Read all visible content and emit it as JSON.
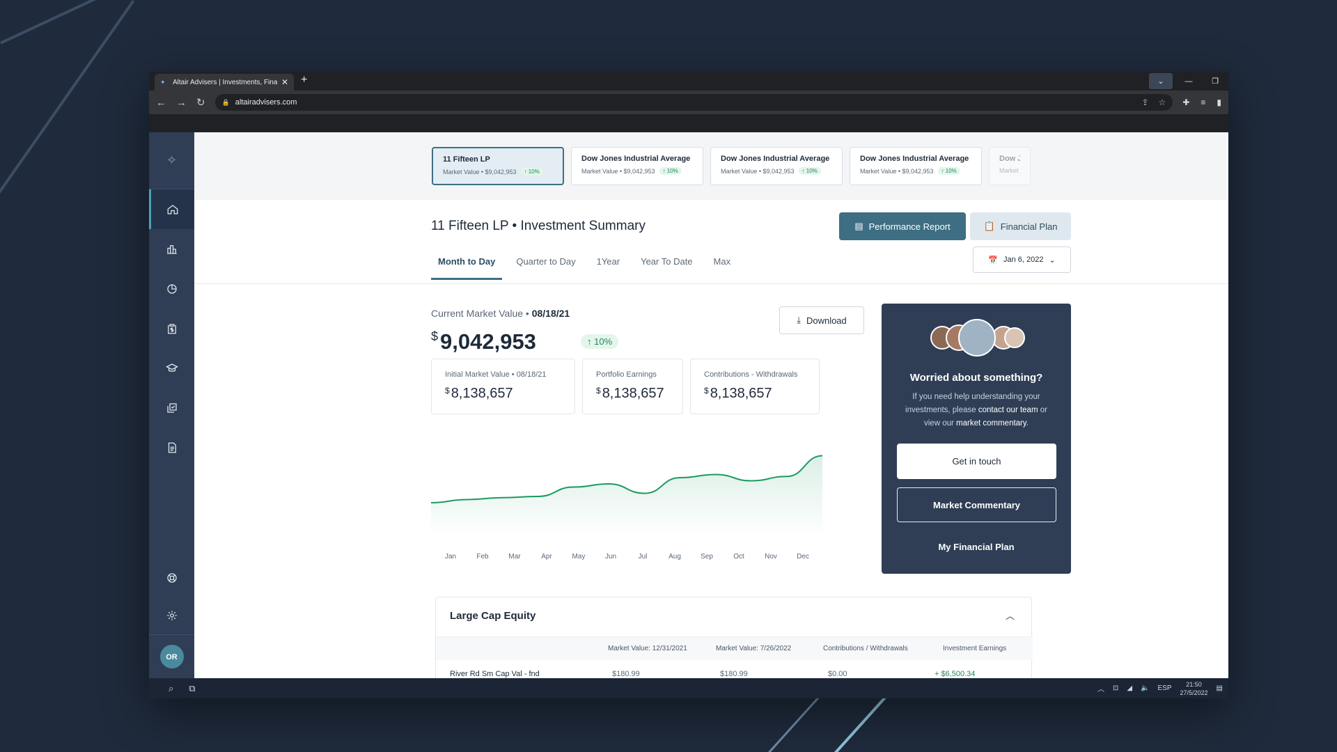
{
  "browser": {
    "tab_title": "Altair Advisers | Investments, Fina",
    "url": "altairadvisers.com"
  },
  "accounts": [
    {
      "name": "11 Fifteen LP",
      "market_value": "Market Value • $9,042,953",
      "change": "↑ 10%",
      "active": true
    },
    {
      "name": "Dow Jones Industrial Average",
      "market_value": "Market Value • $9,042,953",
      "change": "↑ 10%"
    },
    {
      "name": "Dow Jones Industrial Average",
      "market_value": "Market Value • $9,042,953",
      "change": "↑ 10%"
    },
    {
      "name": "Dow Jones Industrial Average",
      "market_value": "Market Value • $9,042,953",
      "change": "↑ 10%"
    },
    {
      "name": "Dow Jo",
      "market_value": "Market"
    }
  ],
  "page": {
    "title": "11 Fifteen LP • Investment Summary",
    "performance_report": "Performance Report",
    "financial_plan": "Financial Plan",
    "date": "Jan 6, 2022"
  },
  "tabs": [
    "Month to Day",
    "Quarter to Day",
    "1Year",
    "Year To Date",
    "Max"
  ],
  "summary": {
    "cmv_label": "Current Market Value •",
    "cmv_date": "08/18/21",
    "currency": "$",
    "cmv_value": "9,042,953",
    "cmv_change": "↑ 10%",
    "download": "Download"
  },
  "stats": [
    {
      "label": "Initial Market Value • 08/18/21",
      "value": "8,138,657"
    },
    {
      "label": "Portfolio Earnings",
      "value": "8,138,657"
    },
    {
      "label": "Contributions - Withdrawals",
      "value": "8,138,657"
    }
  ],
  "chart_data": {
    "type": "area",
    "categories": [
      "Jan",
      "Feb",
      "Mar",
      "Apr",
      "May",
      "Jun",
      "Jul",
      "Aug",
      "Sep",
      "Oct",
      "Nov",
      "Dec"
    ],
    "values": [
      0.2,
      0.25,
      0.28,
      0.3,
      0.45,
      0.5,
      0.35,
      0.6,
      0.65,
      0.55,
      0.62,
      0.95
    ],
    "color": "#1c9a62",
    "ylim": [
      0,
      1
    ],
    "grid": false
  },
  "help": {
    "title": "Worried about something?",
    "body_1": "If you need help understanding your investments, please",
    "link_1": "contact our team",
    "body_2": "or view our",
    "link_2": "market commentary",
    "body_3": ".",
    "get_in_touch": "Get in touch",
    "market_commentary": "Market Commentary",
    "my_plan": "My Financial Plan"
  },
  "equity": {
    "title": "Large Cap Equity",
    "columns": [
      "Market Value: 12/31/2021",
      "Market Value: 7/26/2022",
      "Contributions / Withdrawals",
      "Investment Earnings"
    ],
    "first_row": [
      "River Rd Sm Cap Val - fnd",
      "$180.99",
      "$180.99",
      "$0.00",
      "+ $6,500.34"
    ]
  },
  "user": {
    "initials": "OR"
  },
  "taskbar": {
    "lang": "ESP",
    "time": "21:50",
    "date": "27/5/2022"
  },
  "colors": {
    "accent": "#3d6e83",
    "sidebar": "#2f3e55",
    "positive": "#1c8a5a"
  }
}
